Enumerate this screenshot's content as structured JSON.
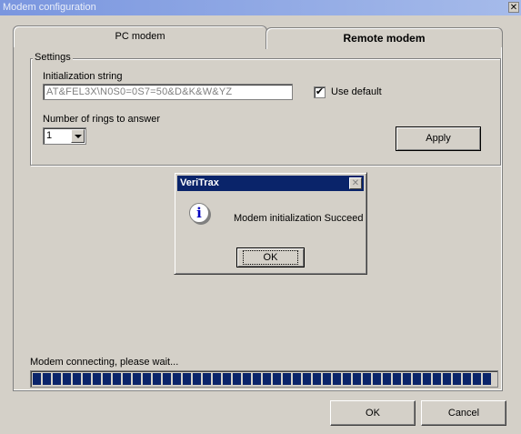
{
  "window": {
    "title": "Modem configuration",
    "close_glyph": "✕"
  },
  "tabs": [
    {
      "label": "PC modem",
      "active": false
    },
    {
      "label": "Remote modem",
      "active": true
    }
  ],
  "settings": {
    "group_label": "Settings",
    "init_label": "Initialization string",
    "init_value": "AT&FEL3X\\N0S0=0S7=50&D&K&W&YZ",
    "use_default_label": "Use default",
    "use_default_checked": "✔",
    "rings_label": "Number of rings to answer",
    "rings_value": "1",
    "apply_label": "Apply"
  },
  "dialog": {
    "title": "VeriTrax",
    "close_glyph": "✕",
    "icon": "info-icon",
    "icon_glyph": "i",
    "message": "Modem initialization Succeed",
    "ok_label": "OK"
  },
  "status": {
    "text": "Modem connecting, please wait...",
    "progress_percent": 100
  },
  "footer": {
    "ok_label": "OK",
    "cancel_label": "Cancel"
  },
  "colors": {
    "face": "#d4d0c8",
    "dialog_title": "#0a246a",
    "progress": "#0a246a"
  }
}
